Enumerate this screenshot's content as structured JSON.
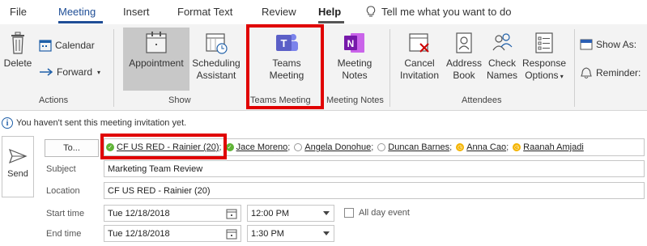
{
  "tabs": [
    "File",
    "Meeting",
    "Insert",
    "Format Text",
    "Review",
    "Help"
  ],
  "tell_me": "Tell me what you want to do",
  "ribbon": {
    "delete": "Delete",
    "calendar": "Calendar",
    "forward": "Forward",
    "actions_label": "Actions",
    "appointment": "Appointment",
    "scheduling_1": "Scheduling",
    "scheduling_2": "Assistant",
    "show_label": "Show",
    "teams_1": "Teams",
    "teams_2": "Meeting",
    "teams_label": "Teams Meeting",
    "notes_1": "Meeting",
    "notes_2": "Notes",
    "notes_label": "Meeting Notes",
    "cancel_1": "Cancel",
    "cancel_2": "Invitation",
    "address_1": "Address",
    "address_2": "Book",
    "check_1": "Check",
    "check_2": "Names",
    "response_1": "Response",
    "response_2": "Options",
    "attendees_label": "Attendees",
    "show_as": "Show As:",
    "reminder": "Reminder:"
  },
  "info": "You haven't sent this meeting invitation yet.",
  "form": {
    "send": "Send",
    "to_button": "To...",
    "subject_label": "Subject",
    "subject_value": "Marketing Team Review",
    "location_label": "Location",
    "location_value": "CF US RED - Rainier (20)",
    "start_label": "Start time",
    "start_date": "Tue 12/18/2018",
    "start_time": "12:00 PM",
    "end_label": "End time",
    "end_date": "Tue 12/18/2018",
    "end_time": "1:30 PM",
    "all_day": "All day event"
  },
  "recipients": [
    {
      "name": "CF US RED - Rainier (20)",
      "status": "available"
    },
    {
      "name": "Jace Moreno",
      "status": "available"
    },
    {
      "name": "Angela Donohue",
      "status": "offline"
    },
    {
      "name": "Duncan Barnes",
      "status": "offline"
    },
    {
      "name": "Anna Cao",
      "status": "away"
    },
    {
      "name": "Raanah Amjadi",
      "status": "away"
    }
  ],
  "colors": {
    "accent": "#1f4e96",
    "highlight": "#e00000",
    "teams": "#5b5fc7",
    "onenote": "#7719aa"
  }
}
